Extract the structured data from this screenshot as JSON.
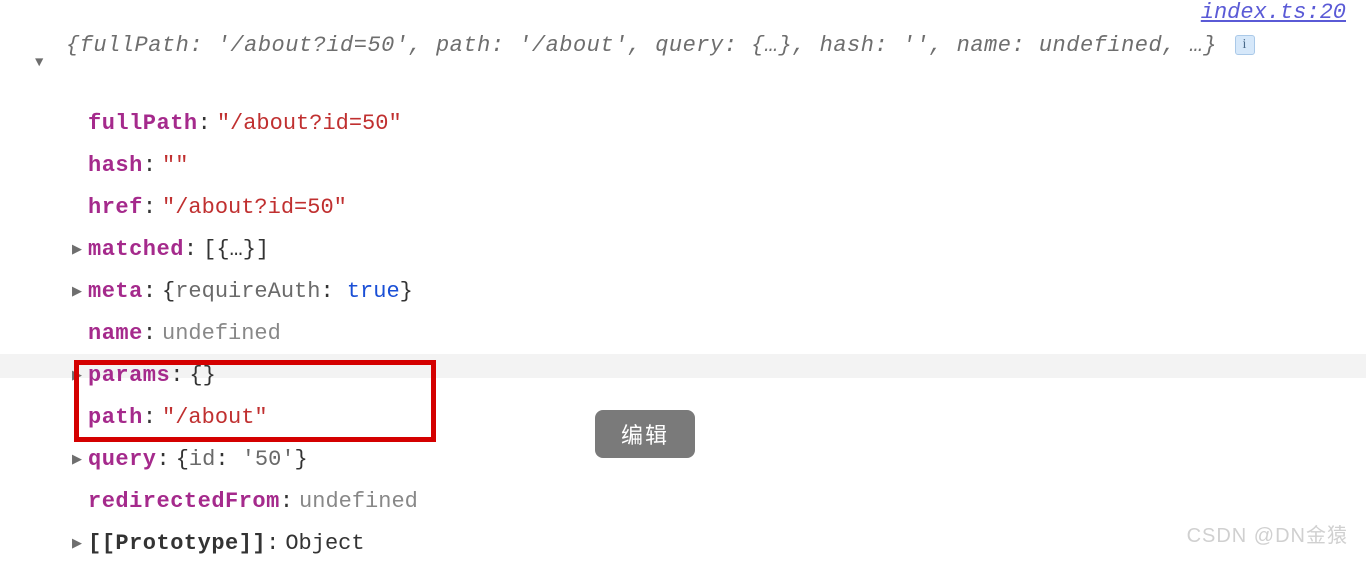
{
  "sourceLink": "index.ts:20",
  "summary": "{fullPath: '/about?id=50', path: '/about', query: {…}, hash: '', name: undefined, …}",
  "infoBadge": "i",
  "props": [
    {
      "arrow": false,
      "key": "fullPath",
      "colon": ":",
      "valueHtml": "string",
      "value": "\"/about?id=50\""
    },
    {
      "arrow": false,
      "key": "hash",
      "colon": ":",
      "valueHtml": "string",
      "value": "\"\""
    },
    {
      "arrow": false,
      "key": "href",
      "colon": ":",
      "valueHtml": "string",
      "value": "\"/about?id=50\""
    },
    {
      "arrow": true,
      "key": "matched",
      "colon": ":",
      "valueHtml": "obj",
      "value": "[{…}]"
    },
    {
      "arrow": true,
      "key": "meta",
      "colon": ":",
      "valueHtml": "meta",
      "value": ""
    },
    {
      "arrow": false,
      "key": "name",
      "colon": ":",
      "valueHtml": "undef",
      "value": "undefined"
    },
    {
      "arrow": true,
      "key": "params",
      "colon": ":",
      "valueHtml": "obj",
      "value": "{}"
    },
    {
      "arrow": false,
      "key": "path",
      "colon": ":",
      "valueHtml": "string",
      "value": "\"/about\""
    },
    {
      "arrow": true,
      "key": "query",
      "colon": ":",
      "valueHtml": "query",
      "value": ""
    },
    {
      "arrow": false,
      "key": "redirectedFrom",
      "colon": ":",
      "valueHtml": "undef",
      "value": "undefined"
    },
    {
      "arrow": true,
      "key": "[[Prototype]]",
      "colon": ":",
      "valueHtml": "obj",
      "value": "Object",
      "proto": true
    }
  ],
  "metaInner": {
    "open": "{",
    "k": "requireAuth",
    "sep": ": ",
    "v": "true",
    "close": "}"
  },
  "queryInner": {
    "open": "{",
    "k": "id",
    "sep": ": ",
    "v": "'50'",
    "close": "}"
  },
  "editButton": "编辑",
  "watermark": "CSDN @DN金猿"
}
